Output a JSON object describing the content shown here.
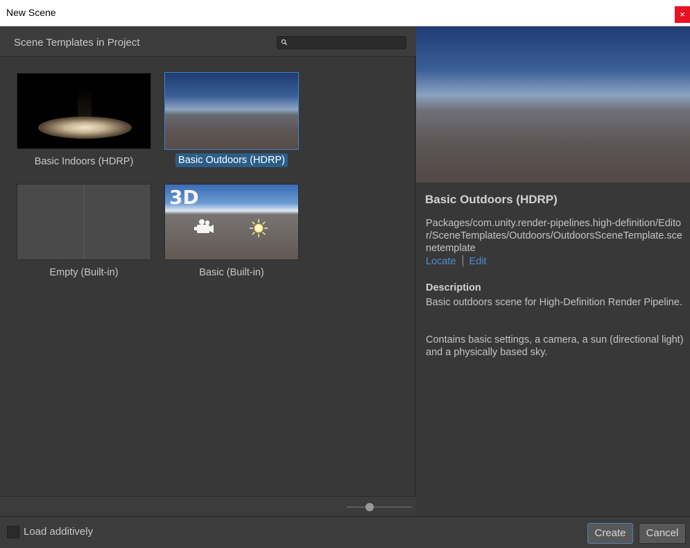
{
  "window": {
    "title": "New Scene",
    "close_glyph": "×"
  },
  "left_panel": {
    "header": "Scene Templates in Project",
    "search": {
      "value": "",
      "placeholder": "",
      "icon": "search-icon"
    },
    "templates": [
      {
        "label": "Basic Indoors (HDRP)",
        "selected": false
      },
      {
        "label": "Basic Outdoors (HDRP)",
        "selected": true
      },
      {
        "label": "Empty (Built-in)",
        "selected": false
      },
      {
        "label": "Basic (Built-in)",
        "selected": false,
        "badge": "3D"
      }
    ],
    "zoom_slider": {
      "value": 0.33
    }
  },
  "details": {
    "title": "Basic Outdoors (HDRP)",
    "path": "Packages/com.unity.render-pipelines.high-definition/Editor/SceneTemplates/Outdoors/OutdoorsSceneTemplate.scenetemplate",
    "locate_label": "Locate",
    "edit_label": "Edit",
    "description_heading": "Description",
    "description_line1": "Basic outdoors scene for High-Definition Render Pipeline.",
    "description_line2": "Contains basic settings, a camera, a sun (directional light) and a physically based sky."
  },
  "footer": {
    "load_additively_label": "Load additively",
    "load_additively_checked": false,
    "create_label": "Create",
    "cancel_label": "Cancel"
  },
  "colors": {
    "accent": "#3d83c7",
    "selection": "#2c5d87",
    "link": "#4c8cd6",
    "close": "#e81123"
  }
}
